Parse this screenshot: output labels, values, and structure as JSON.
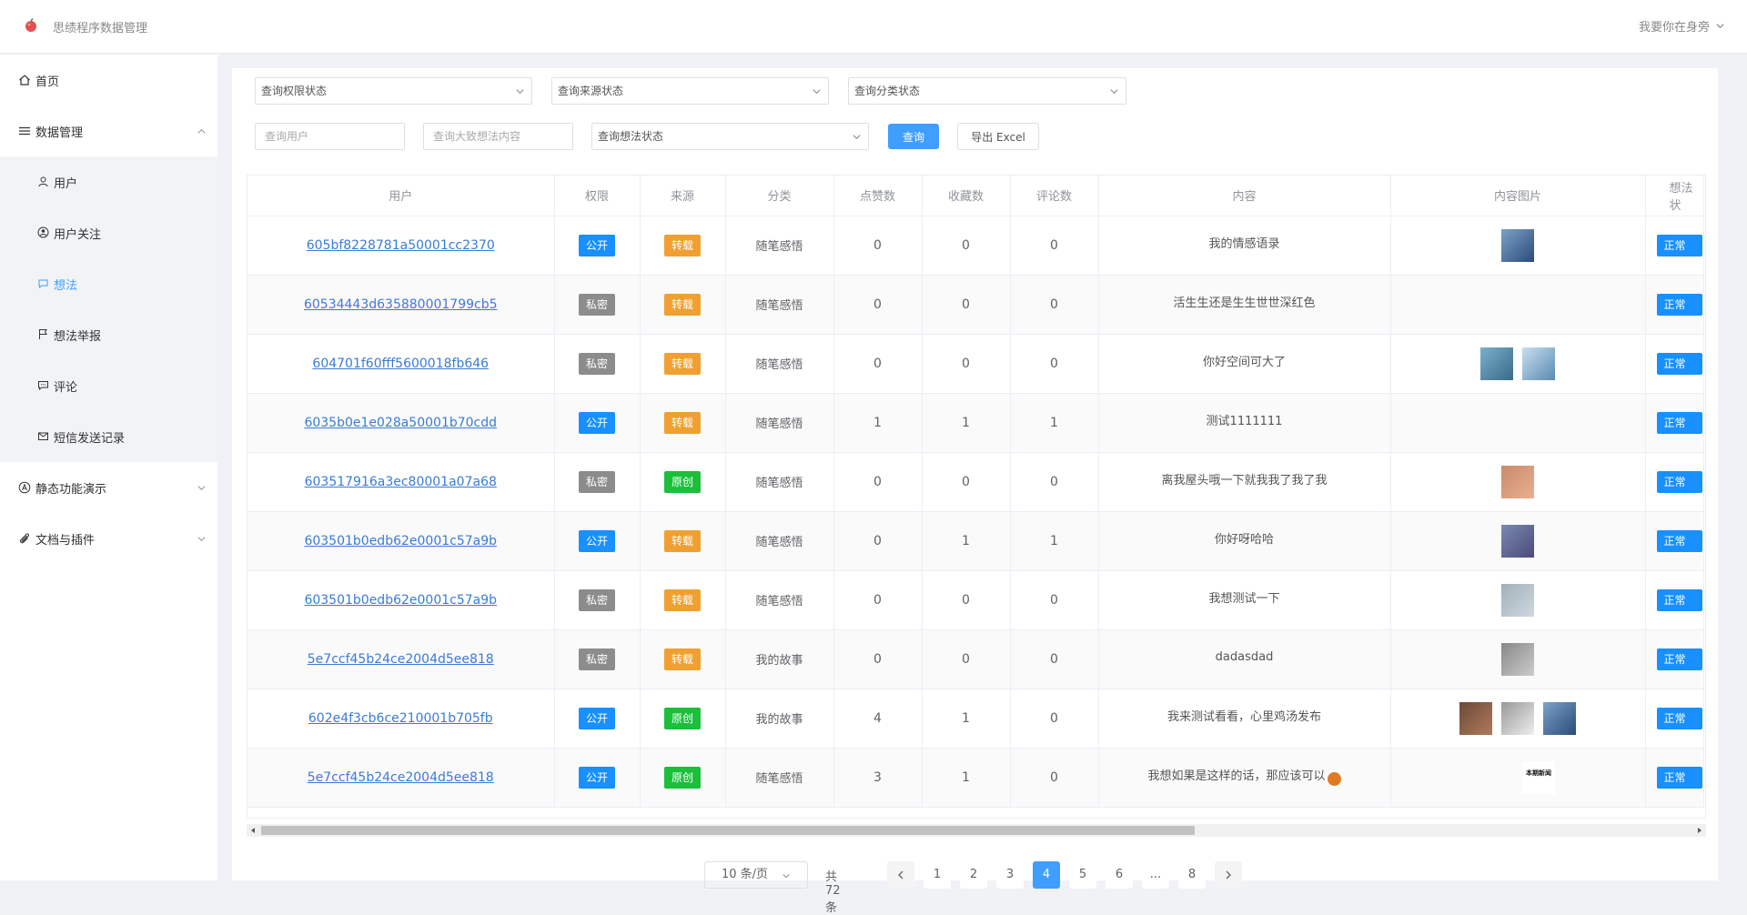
{
  "header": {
    "app_title": "思绩程序数据管理",
    "user_name": "我要你在身旁"
  },
  "sidebar": {
    "home": "首页",
    "data_management": "数据管理",
    "sub_items": [
      "用户",
      "用户关注",
      "想法",
      "想法举报",
      "评论",
      "短信发送记录"
    ],
    "active_sub": "想法",
    "static_demo": "静态功能演示",
    "docs_plugins": "文档与插件"
  },
  "filters": {
    "permission_status": "查询权限状态",
    "source_status": "查询来源状态",
    "category_status": "查询分类状态",
    "user_placeholder": "查询用户",
    "content_placeholder": "查询大致想法内容",
    "idea_status": "查询想法状态",
    "query_button": "查询",
    "export_button": "导出 Excel"
  },
  "table": {
    "columns": [
      "用户",
      "权限",
      "来源",
      "分类",
      "点赞数",
      "收藏数",
      "评论数",
      "内容",
      "内容图片",
      "想法状"
    ],
    "rows": [
      {
        "user": "605bf8228781a50001cc2370",
        "permission": "公开",
        "source": "转载",
        "category": "随笔感悟",
        "likes": "0",
        "favorites": "0",
        "comments": "0",
        "content": "我的情感语录",
        "images": 1,
        "status": "正常"
      },
      {
        "user": "60534443d635880001799cb5",
        "permission": "私密",
        "source": "转载",
        "category": "随笔感悟",
        "likes": "0",
        "favorites": "0",
        "comments": "0",
        "content": "活生生还是生生世世深红色",
        "images": 0,
        "status": "正常"
      },
      {
        "user": "604701f60fff5600018fb646",
        "permission": "私密",
        "source": "转载",
        "category": "随笔感悟",
        "likes": "0",
        "favorites": "0",
        "comments": "0",
        "content": "你好空间可大了",
        "images": 2,
        "status": "正常"
      },
      {
        "user": "6035b0e1e028a50001b70cdd",
        "permission": "公开",
        "source": "转载",
        "category": "随笔感悟",
        "likes": "1",
        "favorites": "1",
        "comments": "1",
        "content": "测试1111111",
        "images": 0,
        "status": "正常"
      },
      {
        "user": "603517916a3ec80001a07a68",
        "permission": "私密",
        "source": "原创",
        "category": "随笔感悟",
        "likes": "0",
        "favorites": "0",
        "comments": "0",
        "content": "离我屋头哦一下就我我了我了我",
        "images": 1,
        "status": "正常"
      },
      {
        "user": "603501b0edb62e0001c57a9b",
        "permission": "公开",
        "source": "转载",
        "category": "随笔感悟",
        "likes": "0",
        "favorites": "1",
        "comments": "1",
        "content": "你好呀哈哈",
        "images": 1,
        "status": "正常"
      },
      {
        "user": "603501b0edb62e0001c57a9b",
        "permission": "私密",
        "source": "转载",
        "category": "随笔感悟",
        "likes": "0",
        "favorites": "0",
        "comments": "0",
        "content": "我想测试一下",
        "images": 1,
        "status": "正常"
      },
      {
        "user": "5e7ccf45b24ce2004d5ee818",
        "permission": "私密",
        "source": "转载",
        "category": "我的故事",
        "likes": "0",
        "favorites": "0",
        "comments": "0",
        "content": "dadasdad",
        "images": 1,
        "status": "正常"
      },
      {
        "user": "602e4f3cb6ce210001b705fb",
        "permission": "公开",
        "source": "原创",
        "category": "我的故事",
        "likes": "4",
        "favorites": "1",
        "comments": "0",
        "content": "我来测试看看，心里鸡汤发布",
        "images": 3,
        "status": "正常"
      },
      {
        "user": "5e7ccf45b24ce2004d5ee818",
        "permission": "公开",
        "source": "原创",
        "category": "随笔感悟",
        "likes": "3",
        "favorites": "1",
        "comments": "0",
        "content": "我想如果是这样的话，那应该可以",
        "images": 2,
        "status": "正常"
      }
    ],
    "thumb_labels": {
      "row9_second": "本期新闻"
    }
  },
  "pagination": {
    "page_size": "10 条/页",
    "total": "共 72 条",
    "pages": [
      "1",
      "2",
      "3",
      "4",
      "5",
      "6",
      "...",
      "8"
    ],
    "current": "4"
  },
  "colors": {
    "primary": "#409eff",
    "tag_public": "#1890ff",
    "tag_private": "#8c8c8c",
    "tag_repost": "#f0a030",
    "tag_original": "#1bbf3a"
  }
}
